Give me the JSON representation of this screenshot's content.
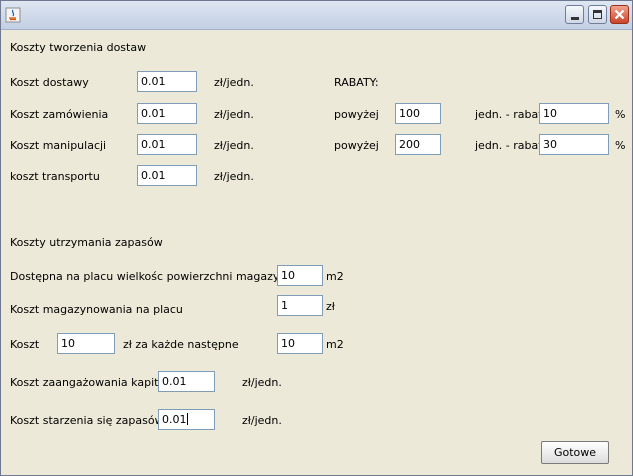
{
  "window": {
    "title": ""
  },
  "delivery": {
    "section_title": "Koszty tworzenia dostaw",
    "rows": [
      {
        "label": "Koszt dostawy",
        "value": "0.01",
        "unit": "zł/jedn."
      },
      {
        "label": "Koszt zamówienia",
        "value": "0.01",
        "unit": "zł/jedn."
      },
      {
        "label": "Koszt manipulacji",
        "value": "0.01",
        "unit": "zł/jedn."
      },
      {
        "label": "koszt transportu",
        "value": "0.01",
        "unit": "zł/jedn."
      }
    ]
  },
  "rebates": {
    "title": "RABATY:",
    "rows": [
      {
        "label": "powyżej",
        "qty": "100",
        "label2": "jedn. - rabat",
        "value": "10",
        "unit": "%"
      },
      {
        "label": "powyżej",
        "qty": "200",
        "label2": "jedn. - rabat",
        "value": "30",
        "unit": "%"
      }
    ]
  },
  "storage": {
    "section_title": "Koszty utrzymania zapasów",
    "available_area": {
      "label": "Dostępna na placu wielkośc powierzchni magazynowej:",
      "value": "10",
      "unit": "m2"
    },
    "storage_cost": {
      "label": "Koszt magazynowania na placu",
      "value": "1",
      "unit": "zł"
    },
    "extra_cost": {
      "label": "Koszt",
      "value": "10",
      "label2": "zł za każde następne",
      "value2": "10",
      "unit": "m2"
    },
    "capital_cost": {
      "label": "Koszt zaangażowania kapitału",
      "value": "0.01",
      "unit": "zł/jedn."
    },
    "aging_cost": {
      "label": "Koszt starzenia się zapasów",
      "value": "0.01",
      "unit": "zł/jedn."
    }
  },
  "buttons": {
    "done": "Gotowe"
  }
}
